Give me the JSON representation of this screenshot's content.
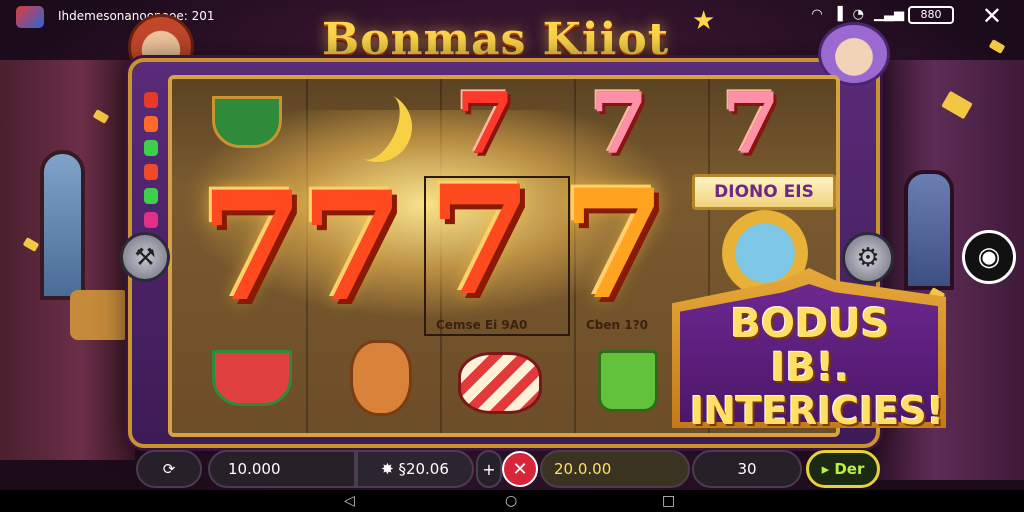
{
  "status_bar": {
    "text": "Ihdemesonanoonooe: 201",
    "battery": "880",
    "icons": [
      "wifi-icon",
      "signal-icon",
      "alarm-icon",
      "signal-bars-icon"
    ]
  },
  "game": {
    "title": "Bonmas Kiiot",
    "bonus_plate": "DIONO EIS",
    "promo_line1": "BODUS IB!.",
    "promo_line2": "INTERICIES!",
    "cell_label_1": "Cemse  Ei  9A0",
    "cell_label_2": "Cben  1?0"
  },
  "reels": {
    "symbols": {
      "top": [
        "teacup",
        "banana",
        "seven-red",
        "seven-pink",
        "seven-pink"
      ],
      "middle": [
        "seven-big",
        "seven-big",
        "seven-big",
        "medal"
      ],
      "bottom": [
        "teacup",
        "cat",
        "candy",
        "jar"
      ]
    },
    "seven_glyph": "7"
  },
  "bottom_bar": {
    "bet": "10.000",
    "credit": "✸ §20.06",
    "plus": "+",
    "cancel": "✕",
    "win": "20.0.00",
    "lines": "30",
    "go": "▸ Der"
  },
  "colors": {
    "title": "#ffd84a",
    "frame": "#5a2b79",
    "trim": "#d6a340",
    "promo": "#6d2890",
    "cancel": "#d7263a"
  }
}
